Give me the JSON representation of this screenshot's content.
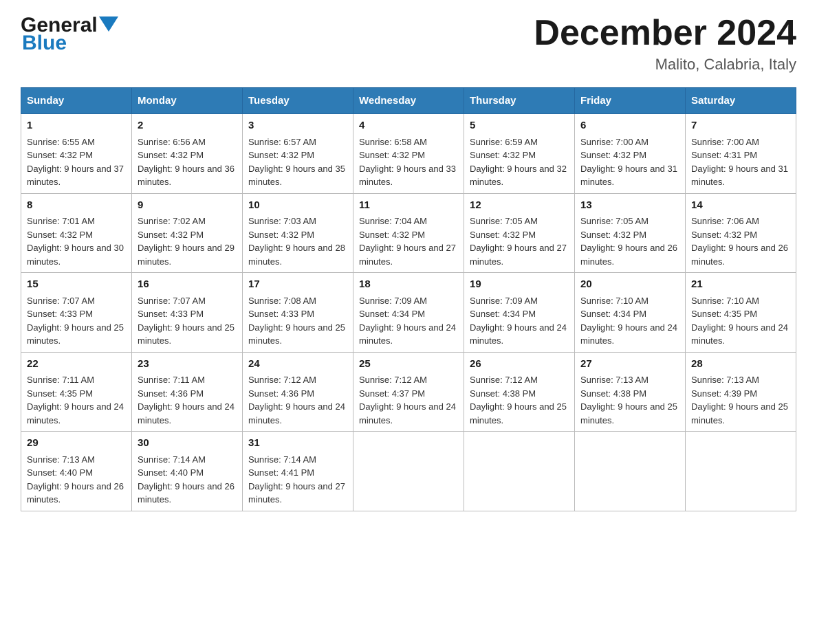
{
  "header": {
    "logo_text_general": "General",
    "logo_text_blue": "Blue",
    "title": "December 2024",
    "subtitle": "Malito, Calabria, Italy"
  },
  "days_of_week": [
    "Sunday",
    "Monday",
    "Tuesday",
    "Wednesday",
    "Thursday",
    "Friday",
    "Saturday"
  ],
  "weeks": [
    [
      {
        "day": "1",
        "sunrise": "6:55 AM",
        "sunset": "4:32 PM",
        "daylight": "9 hours and 37 minutes."
      },
      {
        "day": "2",
        "sunrise": "6:56 AM",
        "sunset": "4:32 PM",
        "daylight": "9 hours and 36 minutes."
      },
      {
        "day": "3",
        "sunrise": "6:57 AM",
        "sunset": "4:32 PM",
        "daylight": "9 hours and 35 minutes."
      },
      {
        "day": "4",
        "sunrise": "6:58 AM",
        "sunset": "4:32 PM",
        "daylight": "9 hours and 33 minutes."
      },
      {
        "day": "5",
        "sunrise": "6:59 AM",
        "sunset": "4:32 PM",
        "daylight": "9 hours and 32 minutes."
      },
      {
        "day": "6",
        "sunrise": "7:00 AM",
        "sunset": "4:32 PM",
        "daylight": "9 hours and 31 minutes."
      },
      {
        "day": "7",
        "sunrise": "7:00 AM",
        "sunset": "4:31 PM",
        "daylight": "9 hours and 31 minutes."
      }
    ],
    [
      {
        "day": "8",
        "sunrise": "7:01 AM",
        "sunset": "4:32 PM",
        "daylight": "9 hours and 30 minutes."
      },
      {
        "day": "9",
        "sunrise": "7:02 AM",
        "sunset": "4:32 PM",
        "daylight": "9 hours and 29 minutes."
      },
      {
        "day": "10",
        "sunrise": "7:03 AM",
        "sunset": "4:32 PM",
        "daylight": "9 hours and 28 minutes."
      },
      {
        "day": "11",
        "sunrise": "7:04 AM",
        "sunset": "4:32 PM",
        "daylight": "9 hours and 27 minutes."
      },
      {
        "day": "12",
        "sunrise": "7:05 AM",
        "sunset": "4:32 PM",
        "daylight": "9 hours and 27 minutes."
      },
      {
        "day": "13",
        "sunrise": "7:05 AM",
        "sunset": "4:32 PM",
        "daylight": "9 hours and 26 minutes."
      },
      {
        "day": "14",
        "sunrise": "7:06 AM",
        "sunset": "4:32 PM",
        "daylight": "9 hours and 26 minutes."
      }
    ],
    [
      {
        "day": "15",
        "sunrise": "7:07 AM",
        "sunset": "4:33 PM",
        "daylight": "9 hours and 25 minutes."
      },
      {
        "day": "16",
        "sunrise": "7:07 AM",
        "sunset": "4:33 PM",
        "daylight": "9 hours and 25 minutes."
      },
      {
        "day": "17",
        "sunrise": "7:08 AM",
        "sunset": "4:33 PM",
        "daylight": "9 hours and 25 minutes."
      },
      {
        "day": "18",
        "sunrise": "7:09 AM",
        "sunset": "4:34 PM",
        "daylight": "9 hours and 24 minutes."
      },
      {
        "day": "19",
        "sunrise": "7:09 AM",
        "sunset": "4:34 PM",
        "daylight": "9 hours and 24 minutes."
      },
      {
        "day": "20",
        "sunrise": "7:10 AM",
        "sunset": "4:34 PM",
        "daylight": "9 hours and 24 minutes."
      },
      {
        "day": "21",
        "sunrise": "7:10 AM",
        "sunset": "4:35 PM",
        "daylight": "9 hours and 24 minutes."
      }
    ],
    [
      {
        "day": "22",
        "sunrise": "7:11 AM",
        "sunset": "4:35 PM",
        "daylight": "9 hours and 24 minutes."
      },
      {
        "day": "23",
        "sunrise": "7:11 AM",
        "sunset": "4:36 PM",
        "daylight": "9 hours and 24 minutes."
      },
      {
        "day": "24",
        "sunrise": "7:12 AM",
        "sunset": "4:36 PM",
        "daylight": "9 hours and 24 minutes."
      },
      {
        "day": "25",
        "sunrise": "7:12 AM",
        "sunset": "4:37 PM",
        "daylight": "9 hours and 24 minutes."
      },
      {
        "day": "26",
        "sunrise": "7:12 AM",
        "sunset": "4:38 PM",
        "daylight": "9 hours and 25 minutes."
      },
      {
        "day": "27",
        "sunrise": "7:13 AM",
        "sunset": "4:38 PM",
        "daylight": "9 hours and 25 minutes."
      },
      {
        "day": "28",
        "sunrise": "7:13 AM",
        "sunset": "4:39 PM",
        "daylight": "9 hours and 25 minutes."
      }
    ],
    [
      {
        "day": "29",
        "sunrise": "7:13 AM",
        "sunset": "4:40 PM",
        "daylight": "9 hours and 26 minutes."
      },
      {
        "day": "30",
        "sunrise": "7:14 AM",
        "sunset": "4:40 PM",
        "daylight": "9 hours and 26 minutes."
      },
      {
        "day": "31",
        "sunrise": "7:14 AM",
        "sunset": "4:41 PM",
        "daylight": "9 hours and 27 minutes."
      },
      null,
      null,
      null,
      null
    ]
  ]
}
